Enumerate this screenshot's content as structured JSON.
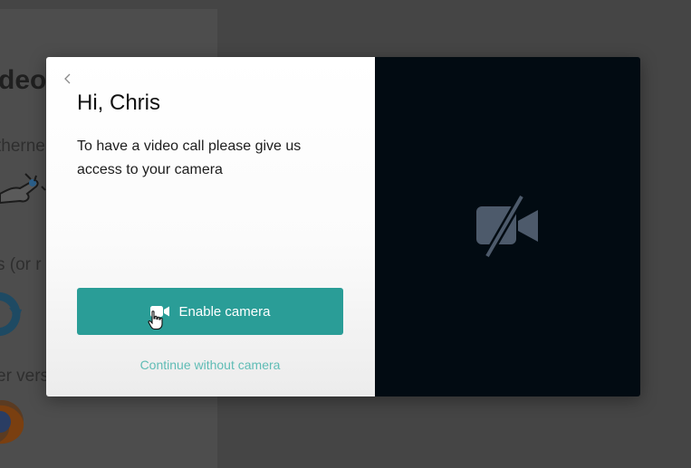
{
  "background": {
    "heading": "deo",
    "lines": [
      "therne",
      "s (or r",
      "er vers"
    ]
  },
  "modal": {
    "greeting": "Hi, Chris",
    "message": "To have a video call please give us access to your camera",
    "enable_button_label": "Enable camera",
    "continue_link": "Continue without camera"
  },
  "icons": {
    "back": "chevron-left-icon",
    "button": "video-camera-icon",
    "preview": "camera-off-icon",
    "cursor": "hand-pointer-icon"
  },
  "colors": {
    "accent": "#2a9d97",
    "link": "#5fbcb5",
    "preview_bg": "#020b12",
    "preview_icon": "#4d5a6b"
  }
}
